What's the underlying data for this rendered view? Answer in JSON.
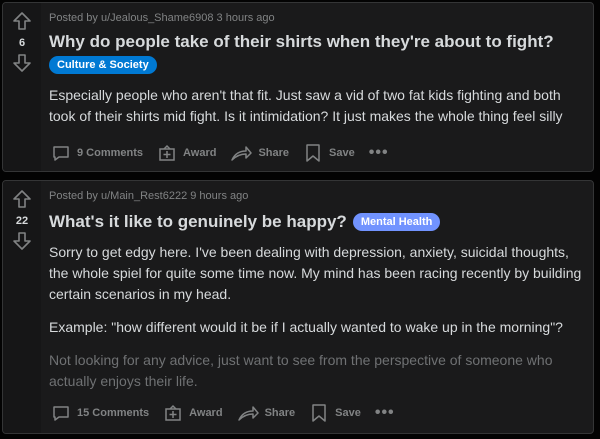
{
  "posts": [
    {
      "score": "6",
      "meta": "Posted by u/Jealous_Shame6908 3 hours ago",
      "title": "Why do people take of their shirts when they're about to fight?",
      "flair": "Culture & Society",
      "flair_color": "#0079d3",
      "body": [
        "Especially people who aren't that fit. Just saw a vid of two fat kids fighting and both took of their shirts mid fight. Is it intimidation? It just makes the whole thing feel silly"
      ],
      "actions": {
        "comments": "9 Comments",
        "award": "Award",
        "share": "Share",
        "save": "Save",
        "more": "•••"
      }
    },
    {
      "score": "22",
      "meta": "Posted by u/Main_Rest6222 9 hours ago",
      "title": "What's it like to genuinely be happy?",
      "flair": "Mental Health",
      "flair_color": "#7193ff",
      "body": [
        "Sorry to get edgy here. I've been dealing with depression, anxiety, suicidal thoughts, the whole spiel for quite some time now. My mind has been racing recently by building certain scenarios in my head.",
        "Example: \"how different would it be if I actually wanted to wake up in the morning\"?",
        "Not looking for any advice, just want to see from the perspective of someone who actually enjoys their life."
      ],
      "actions": {
        "comments": "15 Comments",
        "award": "Award",
        "share": "Share",
        "save": "Save",
        "more": "•••"
      }
    }
  ]
}
